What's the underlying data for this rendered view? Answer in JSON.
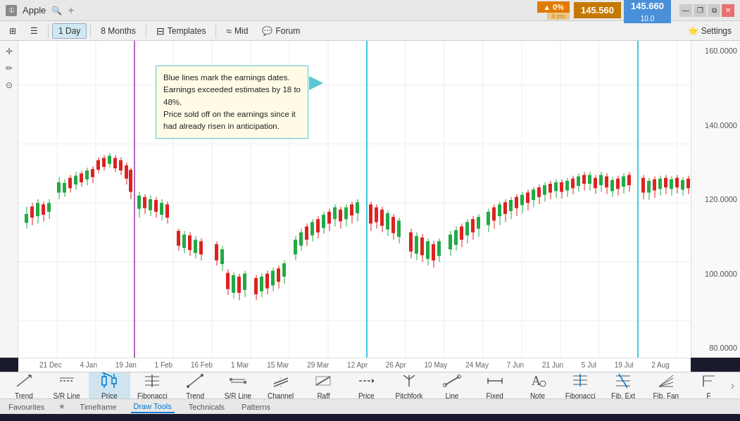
{
  "titleBar": {
    "windowIcon": "①",
    "title": "Apple",
    "searchIcon": "🔍",
    "priceUp": "▲ 0%",
    "priceUpSub": "0 pts",
    "price1": "145.560",
    "price2": "145.660",
    "priceSub": "10.0",
    "winBtns": [
      "—",
      "❐",
      "✕"
    ]
  },
  "toolbar": {
    "gridBtn": "⊞",
    "timeframe": "1 Day",
    "months": "8 Months",
    "templatesIcon": "⊟",
    "templates": "Templates",
    "midIcon": "≈",
    "mid": "Mid",
    "forumIcon": "💬",
    "forum": "Forum",
    "settingsIcon": "⭐",
    "settings": "Settings"
  },
  "dateLabels": [
    "21 Dec",
    "4 Jan",
    "19 Jan",
    "1 Feb",
    "16 Feb",
    "1 Mar",
    "15 Mar",
    "29 Mar",
    "12 Apr",
    "26 Apr",
    "10 May",
    "24 May",
    "7 Jun",
    "21 Jun",
    "5 Jul",
    "19 Jul",
    "2 Aug"
  ],
  "priceLevels": [
    "160.0000",
    "140.0000",
    "120.0000",
    "100.0000",
    "80.0000"
  ],
  "annotation": {
    "line1": "Blue lines mark the earnings dates.",
    "line2": "Earnings exceeded estimates by 18 to",
    "line3": "48%.",
    "line4": "Price sold off on the earnings since it",
    "line5": "had already risen in anticipation."
  },
  "bottomTools": [
    {
      "name": "Trend",
      "id": "trend1"
    },
    {
      "name": "S/R Line",
      "id": "srline1"
    },
    {
      "name": "Price",
      "id": "price1",
      "selected": true
    },
    {
      "name": "Fibonacci",
      "id": "fib1"
    },
    {
      "name": "Trend",
      "id": "trend2"
    },
    {
      "name": "S/R Line",
      "id": "srline2"
    },
    {
      "name": "Channel",
      "id": "channel"
    },
    {
      "name": "Raff",
      "id": "raff"
    },
    {
      "name": "Price",
      "id": "price2"
    },
    {
      "name": "Pitchfork",
      "id": "pitchfork"
    },
    {
      "name": "Line",
      "id": "line"
    },
    {
      "name": "Fixed",
      "id": "fixed"
    },
    {
      "name": "Note",
      "id": "note"
    },
    {
      "name": "Fibonacci",
      "id": "fib2"
    },
    {
      "name": "Fib. Ext",
      "id": "fibext"
    },
    {
      "name": "Fib. Fan",
      "id": "fibfan"
    },
    {
      "name": "F",
      "id": "f"
    }
  ],
  "bottomNav": [
    {
      "label": "Favourites",
      "active": false
    },
    {
      "label": "Timeframe",
      "active": false
    },
    {
      "label": "Draw Tools",
      "active": true
    },
    {
      "label": "Technicals",
      "active": false
    },
    {
      "label": "Patterns",
      "active": false
    }
  ],
  "leftTools": [
    "⊞",
    "☰",
    "⬌"
  ],
  "chartColors": {
    "upCandle": "#22aa44",
    "downCandle": "#dd2222",
    "blueLine1": "#00bcd4",
    "blueLine2": "#00bcd4",
    "vertLine1": "#9c3ab0"
  }
}
